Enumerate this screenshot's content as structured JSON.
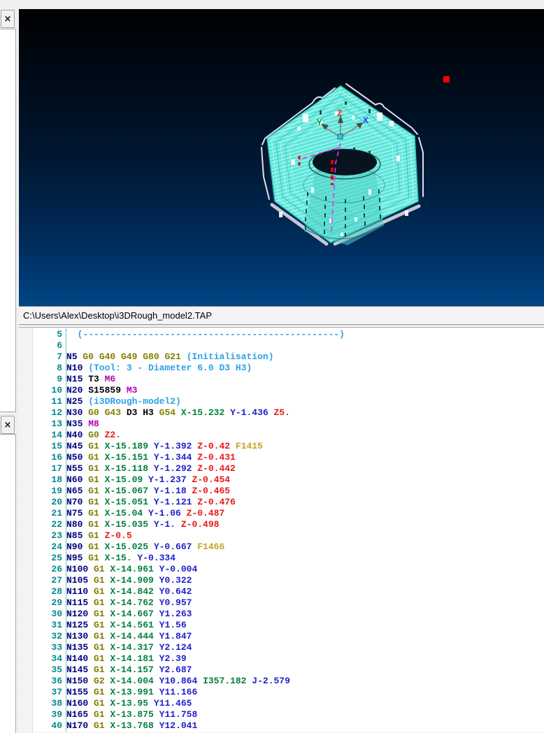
{
  "left_rail": {
    "close_button_glyph": "×"
  },
  "viewport": {
    "axis": {
      "x": "X",
      "y": "Y",
      "z": "Z"
    },
    "colors": {
      "background_top": "#000000",
      "background_bottom": "#004685",
      "toolpath": "#68E9DE",
      "toolpath_light": "#AEF7F0",
      "toolpath_dark": "#2FC4B8",
      "outline": "#DFE0EA",
      "silver_band": "#C4C8D6",
      "axis_x_label": "#2244FF",
      "axis_y_label": "#00A820",
      "axis_z_label": "#F03030",
      "rapid_move": "#E832E8",
      "red_dash": "#E00000",
      "marker": "#FF0000"
    }
  },
  "path_bar": {
    "file_path": "C:\\Users\\Alex\\Desktop\\i3DRough_model2.TAP"
  },
  "editor": {
    "syntax_colors": {
      "ln": "#008B8B",
      "n": "#000080",
      "g": "#808000",
      "x": "#008040",
      "y": "#2020CC",
      "z": "#E81818",
      "f": "#C9A227",
      "m": "#B400B4",
      "k": "#000000",
      "c": "#29A3E6"
    },
    "lines": [
      {
        "n": 5,
        "t": [
          [
            "c",
            "  (-----------------------------------------------)"
          ]
        ]
      },
      {
        "n": 6,
        "t": []
      },
      {
        "n": 7,
        "t": [
          [
            "n",
            "N5"
          ],
          [
            "g",
            "G0"
          ],
          [
            "g",
            "G40"
          ],
          [
            "g",
            "G49"
          ],
          [
            "g",
            "G80"
          ],
          [
            "g",
            "G21"
          ],
          [
            "c",
            "(Initialisation)"
          ]
        ]
      },
      {
        "n": 8,
        "t": [
          [
            "n",
            "N10"
          ],
          [
            "c",
            "(Tool: 3 - Diameter 6.0 D3 H3)"
          ]
        ]
      },
      {
        "n": 9,
        "t": [
          [
            "n",
            "N15"
          ],
          [
            "k",
            "T3"
          ],
          [
            "m",
            "M6"
          ]
        ]
      },
      {
        "n": 10,
        "t": [
          [
            "n",
            "N20"
          ],
          [
            "k",
            "S15859"
          ],
          [
            "m",
            "M3"
          ]
        ]
      },
      {
        "n": 11,
        "t": [
          [
            "n",
            "N25"
          ],
          [
            "c",
            "(i3DRough-model2)"
          ]
        ]
      },
      {
        "n": 12,
        "t": [
          [
            "n",
            "N30"
          ],
          [
            "g",
            "G0"
          ],
          [
            "g",
            "G43"
          ],
          [
            "k",
            "D3"
          ],
          [
            "k",
            "H3"
          ],
          [
            "g",
            "G54"
          ],
          [
            "x",
            "X-15.232"
          ],
          [
            "y",
            "Y-1.436"
          ],
          [
            "z",
            "Z5."
          ]
        ]
      },
      {
        "n": 13,
        "t": [
          [
            "n",
            "N35"
          ],
          [
            "m",
            "M8"
          ]
        ]
      },
      {
        "n": 14,
        "t": [
          [
            "n",
            "N40"
          ],
          [
            "g",
            "G0"
          ],
          [
            "z",
            "Z2."
          ]
        ]
      },
      {
        "n": 15,
        "t": [
          [
            "n",
            "N45"
          ],
          [
            "g",
            "G1"
          ],
          [
            "x",
            "X-15.189"
          ],
          [
            "y",
            "Y-1.392"
          ],
          [
            "z",
            "Z-0.42"
          ],
          [
            "f",
            "F1415"
          ]
        ]
      },
      {
        "n": 16,
        "t": [
          [
            "n",
            "N50"
          ],
          [
            "g",
            "G1"
          ],
          [
            "x",
            "X-15.151"
          ],
          [
            "y",
            "Y-1.344"
          ],
          [
            "z",
            "Z-0.431"
          ]
        ]
      },
      {
        "n": 17,
        "t": [
          [
            "n",
            "N55"
          ],
          [
            "g",
            "G1"
          ],
          [
            "x",
            "X-15.118"
          ],
          [
            "y",
            "Y-1.292"
          ],
          [
            "z",
            "Z-0.442"
          ]
        ]
      },
      {
        "n": 18,
        "t": [
          [
            "n",
            "N60"
          ],
          [
            "g",
            "G1"
          ],
          [
            "x",
            "X-15.09"
          ],
          [
            "y",
            "Y-1.237"
          ],
          [
            "z",
            "Z-0.454"
          ]
        ]
      },
      {
        "n": 19,
        "t": [
          [
            "n",
            "N65"
          ],
          [
            "g",
            "G1"
          ],
          [
            "x",
            "X-15.067"
          ],
          [
            "y",
            "Y-1.18"
          ],
          [
            "z",
            "Z-0.465"
          ]
        ]
      },
      {
        "n": 20,
        "t": [
          [
            "n",
            "N70"
          ],
          [
            "g",
            "G1"
          ],
          [
            "x",
            "X-15.051"
          ],
          [
            "y",
            "Y-1.121"
          ],
          [
            "z",
            "Z-0.476"
          ]
        ]
      },
      {
        "n": 21,
        "t": [
          [
            "n",
            "N75"
          ],
          [
            "g",
            "G1"
          ],
          [
            "x",
            "X-15.04"
          ],
          [
            "y",
            "Y-1.06"
          ],
          [
            "z",
            "Z-0.487"
          ]
        ]
      },
      {
        "n": 22,
        "t": [
          [
            "n",
            "N80"
          ],
          [
            "g",
            "G1"
          ],
          [
            "x",
            "X-15.035"
          ],
          [
            "y",
            "Y-1."
          ],
          [
            "z",
            "Z-0.498"
          ]
        ]
      },
      {
        "n": 23,
        "t": [
          [
            "n",
            "N85"
          ],
          [
            "g",
            "G1"
          ],
          [
            "z",
            "Z-0.5"
          ]
        ]
      },
      {
        "n": 24,
        "t": [
          [
            "n",
            "N90"
          ],
          [
            "g",
            "G1"
          ],
          [
            "x",
            "X-15.025"
          ],
          [
            "y",
            "Y-0.667"
          ],
          [
            "f",
            "F1466"
          ]
        ]
      },
      {
        "n": 25,
        "t": [
          [
            "n",
            "N95"
          ],
          [
            "g",
            "G1"
          ],
          [
            "x",
            "X-15."
          ],
          [
            "y",
            "Y-0.334"
          ]
        ]
      },
      {
        "n": 26,
        "t": [
          [
            "n",
            "N100"
          ],
          [
            "g",
            "G1"
          ],
          [
            "x",
            "X-14.961"
          ],
          [
            "y",
            "Y-0.004"
          ]
        ]
      },
      {
        "n": 27,
        "t": [
          [
            "n",
            "N105"
          ],
          [
            "g",
            "G1"
          ],
          [
            "x",
            "X-14.909"
          ],
          [
            "y",
            "Y0.322"
          ]
        ]
      },
      {
        "n": 28,
        "t": [
          [
            "n",
            "N110"
          ],
          [
            "g",
            "G1"
          ],
          [
            "x",
            "X-14.842"
          ],
          [
            "y",
            "Y0.642"
          ]
        ]
      },
      {
        "n": 29,
        "t": [
          [
            "n",
            "N115"
          ],
          [
            "g",
            "G1"
          ],
          [
            "x",
            "X-14.762"
          ],
          [
            "y",
            "Y0.957"
          ]
        ]
      },
      {
        "n": 30,
        "t": [
          [
            "n",
            "N120"
          ],
          [
            "g",
            "G1"
          ],
          [
            "x",
            "X-14.667"
          ],
          [
            "y",
            "Y1.263"
          ]
        ]
      },
      {
        "n": 31,
        "t": [
          [
            "n",
            "N125"
          ],
          [
            "g",
            "G1"
          ],
          [
            "x",
            "X-14.561"
          ],
          [
            "y",
            "Y1.56"
          ]
        ]
      },
      {
        "n": 32,
        "t": [
          [
            "n",
            "N130"
          ],
          [
            "g",
            "G1"
          ],
          [
            "x",
            "X-14.444"
          ],
          [
            "y",
            "Y1.847"
          ]
        ]
      },
      {
        "n": 33,
        "t": [
          [
            "n",
            "N135"
          ],
          [
            "g",
            "G1"
          ],
          [
            "x",
            "X-14.317"
          ],
          [
            "y",
            "Y2.124"
          ]
        ]
      },
      {
        "n": 34,
        "t": [
          [
            "n",
            "N140"
          ],
          [
            "g",
            "G1"
          ],
          [
            "x",
            "X-14.181"
          ],
          [
            "y",
            "Y2.39"
          ]
        ]
      },
      {
        "n": 35,
        "t": [
          [
            "n",
            "N145"
          ],
          [
            "g",
            "G1"
          ],
          [
            "x",
            "X-14.157"
          ],
          [
            "y",
            "Y2.687"
          ]
        ]
      },
      {
        "n": 36,
        "t": [
          [
            "n",
            "N150"
          ],
          [
            "g",
            "G2"
          ],
          [
            "x",
            "X-14.004"
          ],
          [
            "y",
            "Y10.864"
          ],
          [
            "x",
            "I357.182"
          ],
          [
            "y",
            "J-2.579"
          ]
        ]
      },
      {
        "n": 37,
        "t": [
          [
            "n",
            "N155"
          ],
          [
            "g",
            "G1"
          ],
          [
            "x",
            "X-13.991"
          ],
          [
            "y",
            "Y11.166"
          ]
        ]
      },
      {
        "n": 38,
        "t": [
          [
            "n",
            "N160"
          ],
          [
            "g",
            "G1"
          ],
          [
            "x",
            "X-13.95"
          ],
          [
            "y",
            "Y11.465"
          ]
        ]
      },
      {
        "n": 39,
        "t": [
          [
            "n",
            "N165"
          ],
          [
            "g",
            "G1"
          ],
          [
            "x",
            "X-13.875"
          ],
          [
            "y",
            "Y11.758"
          ]
        ]
      },
      {
        "n": 40,
        "t": [
          [
            "n",
            "N170"
          ],
          [
            "g",
            "G1"
          ],
          [
            "x",
            "X-13.768"
          ],
          [
            "y",
            "Y12.041"
          ]
        ]
      }
    ]
  }
}
